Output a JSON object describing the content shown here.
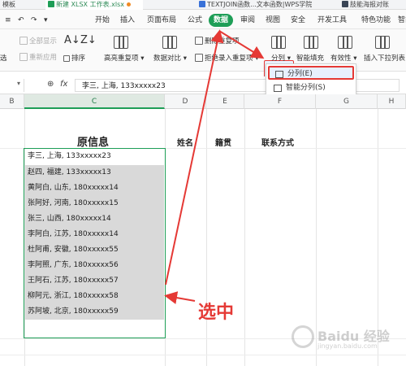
{
  "tabs": [
    {
      "label": "模板",
      "icon": "none"
    },
    {
      "label": "新建 XLSX 工作表.xlsx",
      "icon": "xlsx-icon",
      "active": true
    },
    {
      "label": "TEXTJOIN函数...文本函数|WPS学院",
      "icon": "wps-icon"
    },
    {
      "label": "肢能海报对账",
      "icon": "doc-icon"
    }
  ],
  "menu": [
    "开始",
    "插入",
    "页面布局",
    "公式",
    "数据",
    "审阅",
    "视图",
    "安全",
    "开发工具",
    "特色功能",
    "智能"
  ],
  "menu_active": "数据",
  "toolbar": {
    "show_all": "全部显示",
    "reapply": "重新应用",
    "filter_partial": "选",
    "sort": "排序",
    "highlight_dup": "高亮重复项",
    "data_compare": "数据对比",
    "delete_dup": "删除重复项",
    "reject_dup": "拒绝录入重复项",
    "split": "分列",
    "smart_fill": "智能填充",
    "validity": "有效性",
    "insert_dropdown": "插入下拉列表"
  },
  "dropdown": {
    "items": [
      "分列(E)",
      "智能分列(S)"
    ],
    "selected": "分列(E)"
  },
  "formula_bar": {
    "fx": "fx",
    "value": "李三, 上海, 133xxxxx23"
  },
  "columns": [
    "B",
    "C",
    "D",
    "E",
    "F",
    "G",
    "H"
  ],
  "selected_column": "C",
  "headers": {
    "original": "原信息",
    "name": "姓名",
    "origin": "籍贯",
    "contact": "联系方式"
  },
  "rows": [
    "李三, 上海, 133xxxxx23",
    "赵四, 福建, 133xxxxx13",
    "黄阿白, 山东, 180xxxxx14",
    "张阿好, 河南, 180xxxxx15",
    "张三, 山西, 180xxxxx14",
    "李阿白, 江苏, 180xxxxx14",
    "杜阿甫, 安徽, 180xxxxx55",
    "李阿照, 广东, 180xxxxx56",
    "王阿石, 江苏, 180xxxxx57",
    "柳阿元, 浙江, 180xxxxx58",
    "苏阿坡, 北京, 180xxxxx59"
  ],
  "annotation": {
    "text": "选中",
    "color": "#e53935"
  },
  "watermark": {
    "brand": "Baidu 经验",
    "url": "jingyan.baidu.com"
  },
  "colors": {
    "accent": "#1e9e57",
    "annotation": "#e53935",
    "selection_fill": "#d9d9d9"
  }
}
